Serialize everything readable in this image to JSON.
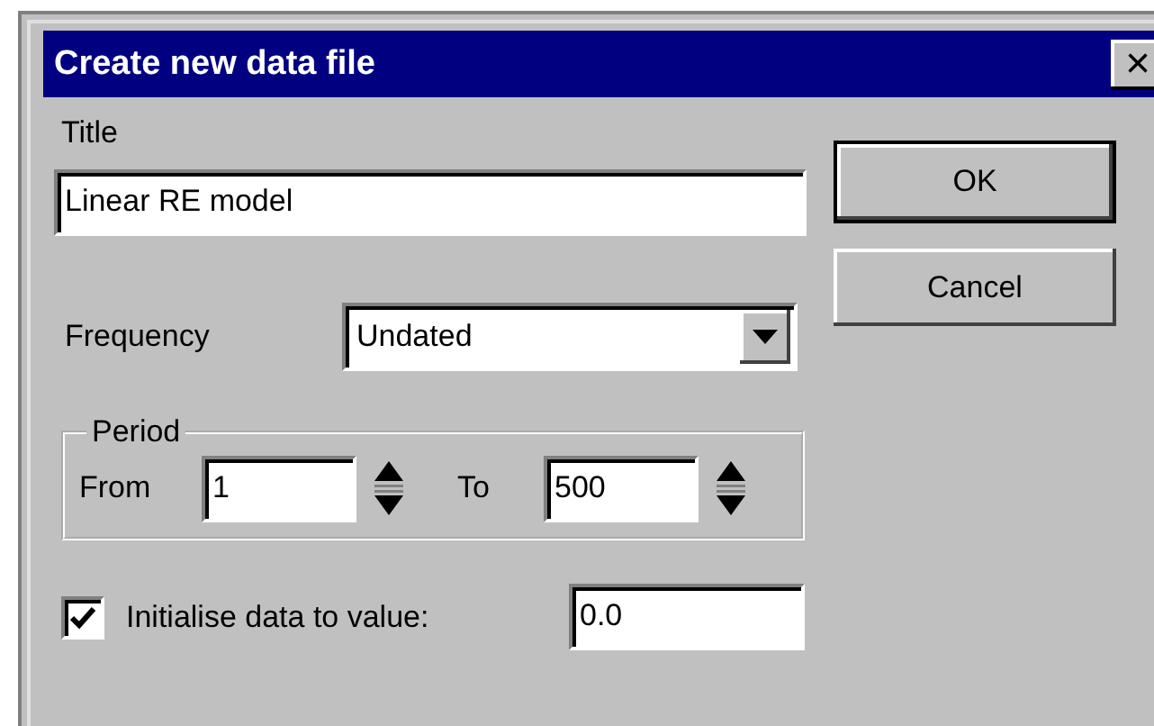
{
  "window": {
    "title": "Create new data file",
    "close_label": "×"
  },
  "title_field": {
    "label": "Title",
    "value": "Linear RE model"
  },
  "buttons": [
    {
      "label": "OK",
      "default": true
    },
    {
      "label": "Cancel",
      "default": false
    }
  ],
  "frequency": {
    "label": "Frequency",
    "value": "Undated"
  },
  "period": {
    "label": "Period",
    "from_label": "From",
    "from_value": "1",
    "to_label": "To",
    "to_value": "500"
  },
  "initialise": {
    "label": "Initialise data to value:",
    "checked": true,
    "value": "0.0"
  }
}
